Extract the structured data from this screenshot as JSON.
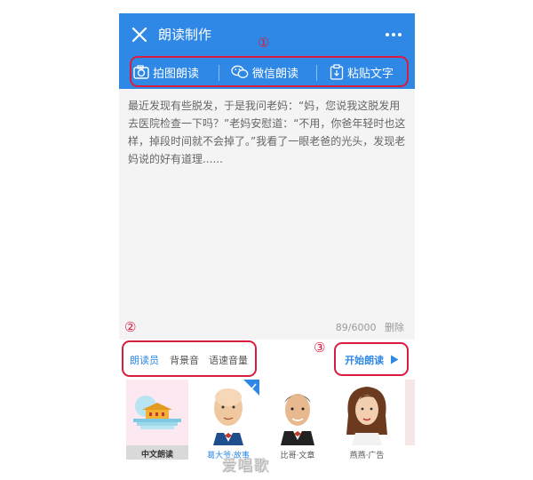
{
  "header": {
    "title": "朗读制作"
  },
  "toolbar": {
    "photo_label": "拍图朗读",
    "wechat_label": "微信朗读",
    "paste_label": "粘贴文字"
  },
  "editor": {
    "text": "最近发现有些脱发，于是我问老妈：“妈，您说我这脱发用去医院检查一下吗？”老妈安慰道：“不用，你爸年轻时也这样，掉段时间就不会掉了。”我看了一眼老爸的光头，发现老妈说的好有道理......",
    "counter": "89/6000",
    "delete_label": "删除"
  },
  "options": {
    "reader_label": "朗读员",
    "bgm_label": "背景音",
    "speed_label": "语速音量",
    "start_label": "开始朗读"
  },
  "voices": [
    {
      "label": "中文朗读"
    },
    {
      "label": "葛大爷·故事"
    },
    {
      "label": "比哥·文章"
    },
    {
      "label": "燕燕·广告"
    }
  ],
  "annotations": {
    "n1": "①",
    "n2": "②",
    "n3": "③"
  },
  "watermark": "爱唱歌",
  "colors": {
    "accent": "#2f88e6",
    "annotation": "#d81e3c"
  }
}
